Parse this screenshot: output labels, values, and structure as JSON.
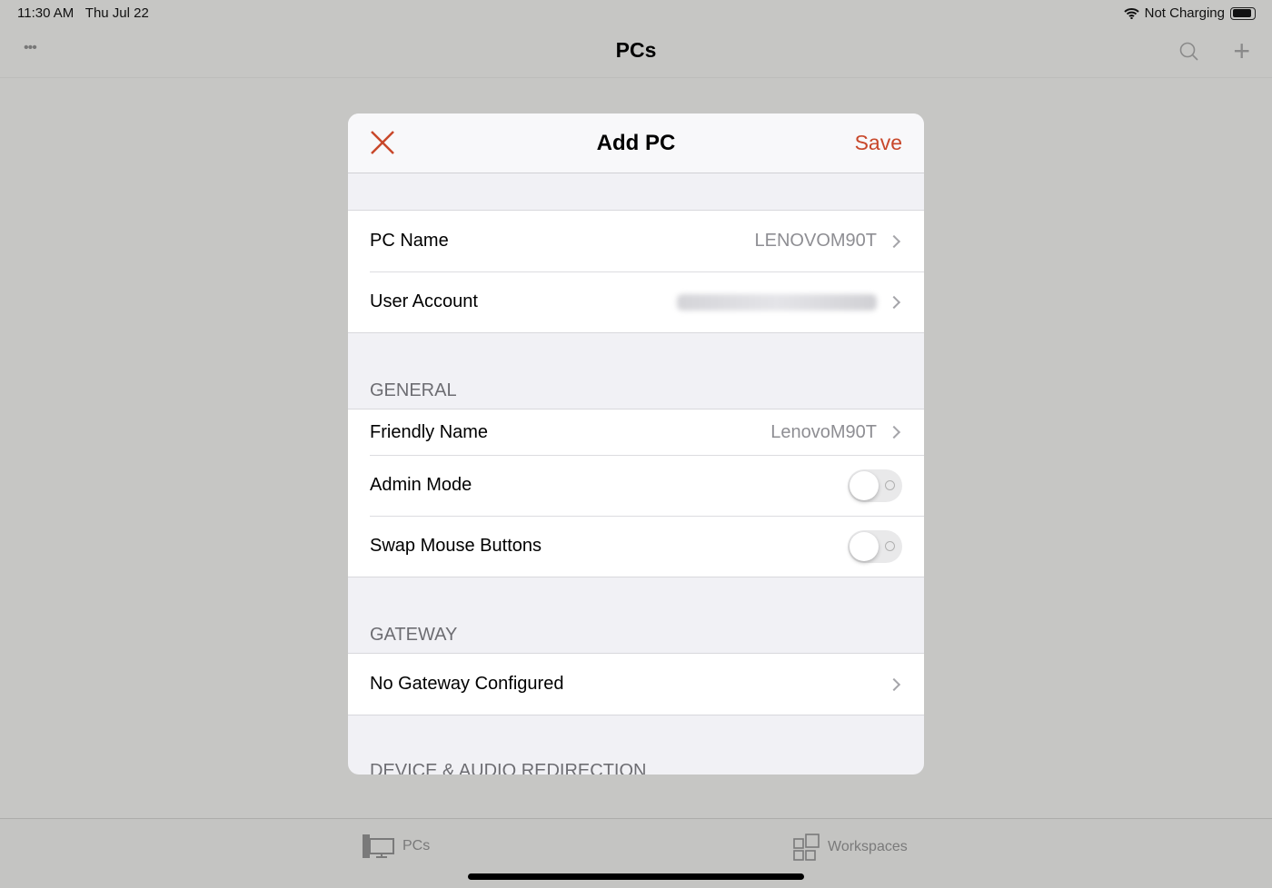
{
  "status": {
    "time": "11:30 AM",
    "date": "Thu Jul 22",
    "battery": "Not Charging",
    "battery_level": 0.9
  },
  "navbar": {
    "title": "PCs",
    "more": "•••"
  },
  "modal": {
    "title": "Add PC",
    "save": "Save",
    "rows": [
      {
        "label": "PC Name",
        "value": "LENOVOM90T"
      },
      {
        "label": "User Account"
      }
    ],
    "general": {
      "header": "GENERAL",
      "friendly_label": "Friendly Name",
      "friendly_value": "LenovoM90T",
      "admin_label": "Admin Mode",
      "admin_on": false,
      "swap_label": "Swap Mouse Buttons",
      "swap_on": false
    },
    "gateway": {
      "header": "GATEWAY",
      "row": "No Gateway Configured"
    },
    "next_header": "DEVICE & AUDIO REDIRECTION"
  },
  "tabs": {
    "pcs": "PCs",
    "workspaces": "Workspaces"
  },
  "colors": {
    "accent": "#c8472a"
  }
}
